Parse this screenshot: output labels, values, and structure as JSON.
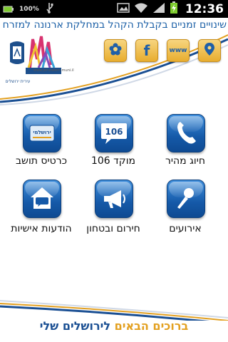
{
  "status_bar": {
    "battery_small": "100%",
    "time": "12:36"
  },
  "ticker": {
    "text": "שינויים זמניים בקבלת הקהל במחלקת ארנונה למזרח ה"
  },
  "header": {
    "logo_text": "עירית ירושלים",
    "logo_url": "www.jerusalem.muni.il",
    "buttons": [
      {
        "name": "flower-icon",
        "label": ""
      },
      {
        "name": "facebook-icon",
        "label": "f"
      },
      {
        "name": "www-icon",
        "label": "www"
      },
      {
        "name": "location-pin-icon",
        "label": ""
      }
    ]
  },
  "tiles": [
    {
      "label": "כרטיס תושב",
      "icon": "resident-card-icon",
      "icon_text": "ירושלמי"
    },
    {
      "label": "מוקד 106",
      "icon": "call-center-106-icon",
      "icon_text": "106"
    },
    {
      "label": "חיוג מהיר",
      "icon": "phone-icon",
      "icon_text": ""
    },
    {
      "label": "הודעות אישיות",
      "icon": "home-message-icon",
      "icon_text": ""
    },
    {
      "label": "חירום ובטחון",
      "icon": "megaphone-icon",
      "icon_text": ""
    },
    {
      "label": "אירועים",
      "icon": "microphone-icon",
      "icon_text": ""
    }
  ],
  "footer": {
    "welcome_a": "ברוכים הבאים",
    "welcome_b": "לירושלים שלי"
  },
  "colors": {
    "tile_blue": "#1559a8",
    "accent_gold": "#e3a020",
    "brand_blue": "#1a4f93"
  }
}
